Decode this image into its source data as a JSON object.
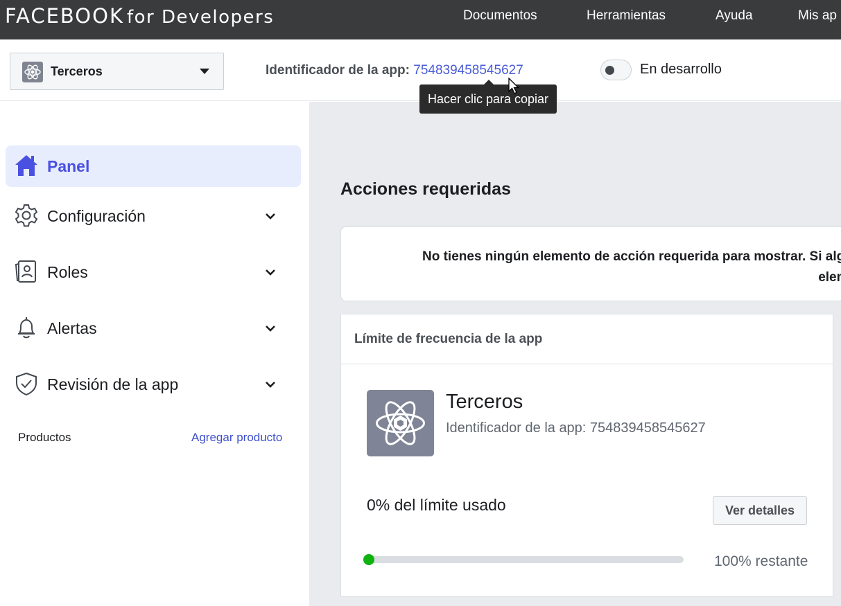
{
  "topbar": {
    "brand_main": "FACEBOOK",
    "brand_sub": "for Developers",
    "nav": [
      "Documentos",
      "Herramientas",
      "Ayuda",
      "Mis ap"
    ]
  },
  "appbar": {
    "app_name": "Terceros",
    "app_id_label": "Identificador de la app:",
    "app_id_value": "754839458545627",
    "mode_label": "En desarrollo",
    "mode_enabled": false
  },
  "tooltip": {
    "text": "Hacer clic para copiar"
  },
  "sidebar": {
    "items": [
      {
        "label": "Panel",
        "icon": "home-icon",
        "active": true
      },
      {
        "label": "Configuración",
        "icon": "gear-icon"
      },
      {
        "label": "Roles",
        "icon": "id-card-icon"
      },
      {
        "label": "Alertas",
        "icon": "bell-icon"
      },
      {
        "label": "Revisión de la app",
        "icon": "shield-check-icon"
      }
    ],
    "products_label": "Productos",
    "add_product_label": "Agregar producto"
  },
  "main": {
    "section_title": "Acciones requeridas",
    "empty_line1": "No tienes ningún elemento de acción requerida para mostrar. Si alguna",
    "empty_line2": "element",
    "rate_limit": {
      "title": "Límite de frecuencia de la app",
      "app_name": "Terceros",
      "app_id": "Identificador de la app: 754839458545627",
      "usage_label": "0% del límite usado",
      "details_button": "Ver detalles",
      "remaining_label": "100% restante",
      "usage_fraction": 0.0
    }
  },
  "colors": {
    "topbar_bg": "#3a3b3c",
    "accent": "#4a50e0",
    "progress_dot": "#0fb20f"
  }
}
